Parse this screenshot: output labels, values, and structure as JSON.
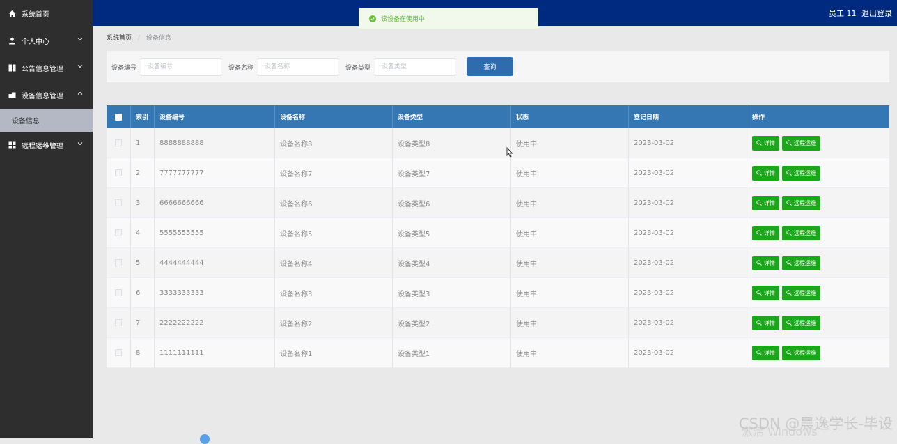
{
  "sidebar": {
    "items": [
      {
        "label": "系统首页",
        "icon": "home-icon",
        "has_chevron": false,
        "expanded": false
      },
      {
        "label": "个人中心",
        "icon": "user-icon",
        "has_chevron": true,
        "expanded": false
      },
      {
        "label": "公告信息管理",
        "icon": "grid-icon",
        "has_chevron": true,
        "expanded": false
      },
      {
        "label": "设备信息管理",
        "icon": "device-icon",
        "has_chevron": true,
        "expanded": true
      },
      {
        "label": "远程运维管理",
        "icon": "grid-icon",
        "has_chevron": true,
        "expanded": false
      }
    ],
    "sub_item": "设备信息"
  },
  "header": {
    "user": "员工 11",
    "logout": "退出登录"
  },
  "toast": {
    "message": "该设备在使用中"
  },
  "breadcrumb": {
    "home": "系统首页",
    "current": "设备信息"
  },
  "search": {
    "fields": [
      {
        "label": "设备编号",
        "placeholder": "设备编号"
      },
      {
        "label": "设备名称",
        "placeholder": "设备名称"
      },
      {
        "label": "设备类型",
        "placeholder": "设备类型"
      }
    ],
    "button": "查询"
  },
  "table": {
    "headers": [
      "索引",
      "设备编号",
      "设备名称",
      "设备类型",
      "状态",
      "登记日期",
      "操作"
    ],
    "detail_label": "详情",
    "remote_label": "远程运维",
    "rows": [
      {
        "index": "1",
        "code": "8888888888",
        "name": "设备名称8",
        "type": "设备类型8",
        "status": "使用中",
        "date": "2023-03-02"
      },
      {
        "index": "2",
        "code": "7777777777",
        "name": "设备名称7",
        "type": "设备类型7",
        "status": "使用中",
        "date": "2023-03-02"
      },
      {
        "index": "3",
        "code": "6666666666",
        "name": "设备名称6",
        "type": "设备类型6",
        "status": "使用中",
        "date": "2023-03-02"
      },
      {
        "index": "4",
        "code": "5555555555",
        "name": "设备名称5",
        "type": "设备类型5",
        "status": "使用中",
        "date": "2023-03-02"
      },
      {
        "index": "5",
        "code": "4444444444",
        "name": "设备名称4",
        "type": "设备类型4",
        "status": "使用中",
        "date": "2023-03-02"
      },
      {
        "index": "6",
        "code": "3333333333",
        "name": "设备名称3",
        "type": "设备类型3",
        "status": "使用中",
        "date": "2023-03-02"
      },
      {
        "index": "7",
        "code": "2222222222",
        "name": "设备名称2",
        "type": "设备类型2",
        "status": "使用中",
        "date": "2023-03-02"
      },
      {
        "index": "8",
        "code": "1111111111",
        "name": "设备名称1",
        "type": "设备类型1",
        "status": "使用中",
        "date": "2023-03-02"
      }
    ]
  },
  "overlay": {
    "watermark": "CSDN @晨逸学长-毕设",
    "activate": "激活 Windows"
  },
  "colors": {
    "header": "#002a7f",
    "sidebar": "#2e2e2e",
    "table_header": "#3577b3",
    "action_button": "#1aa81a",
    "query_button": "#2f6cad",
    "toast": "#67c23a"
  }
}
